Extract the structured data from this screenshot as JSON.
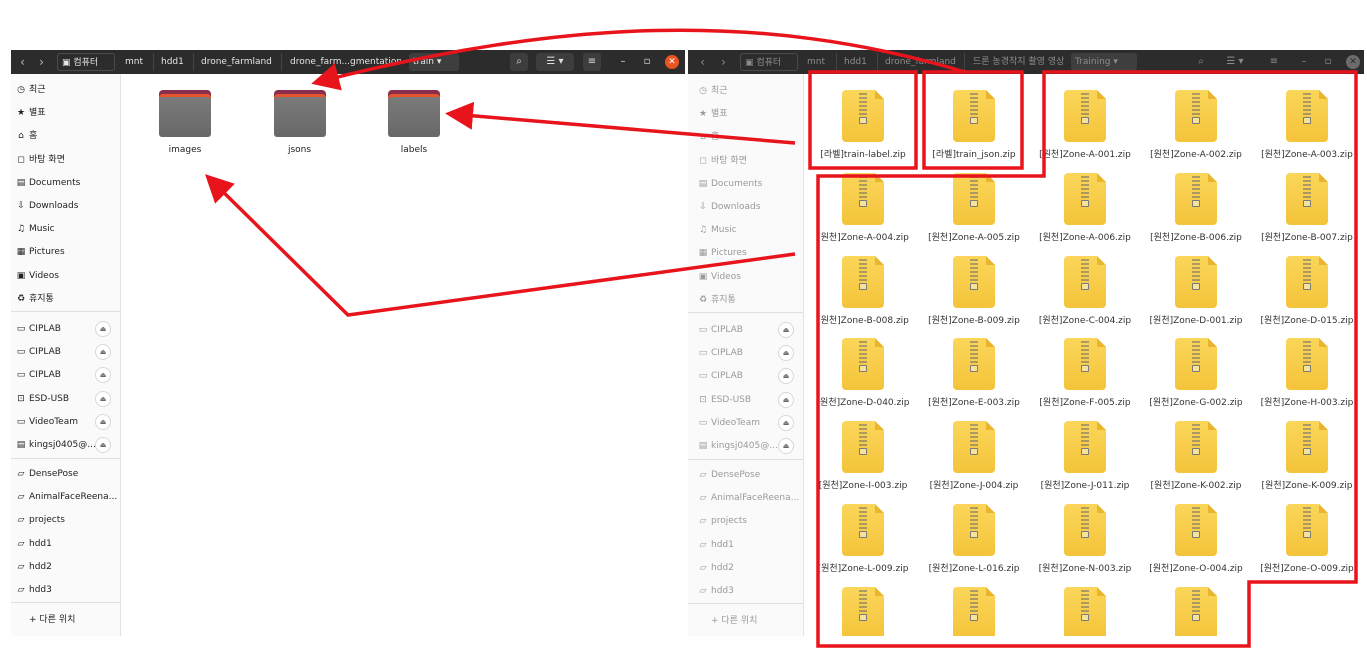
{
  "left": {
    "crumbs": [
      "컴퓨터",
      "mnt",
      "hdd1",
      "drone_farmland",
      "drone_farm...gmentation",
      "train"
    ],
    "sidebar": [
      {
        "label": "최근",
        "icon": "clock-icon"
      },
      {
        "label": "별표",
        "icon": "star-icon"
      },
      {
        "label": "홈",
        "icon": "home-icon"
      },
      {
        "label": "바탕 화면",
        "icon": "desktop-icon"
      },
      {
        "label": "Documents",
        "icon": "document-icon"
      },
      {
        "label": "Downloads",
        "icon": "download-icon"
      },
      {
        "label": "Music",
        "icon": "music-icon"
      },
      {
        "label": "Pictures",
        "icon": "picture-icon"
      },
      {
        "label": "Videos",
        "icon": "video-icon"
      },
      {
        "label": "휴지통",
        "icon": "trash-icon"
      },
      {
        "label": "CIPLAB",
        "icon": "drive-icon"
      },
      {
        "label": "CIPLAB",
        "icon": "drive-icon"
      },
      {
        "label": "CIPLAB",
        "icon": "drive-icon"
      },
      {
        "label": "ESD-USB",
        "icon": "usb-icon"
      },
      {
        "label": "VideoTeam",
        "icon": "drive-icon"
      },
      {
        "label": "kingsj0405@...",
        "icon": "network-drive-icon"
      },
      {
        "label": "DensePose",
        "icon": "folder-icon"
      },
      {
        "label": "AnimalFaceReena...",
        "icon": "folder-icon"
      },
      {
        "label": "projects",
        "icon": "folder-icon"
      },
      {
        "label": "hdd1",
        "icon": "folder-icon"
      },
      {
        "label": "hdd2",
        "icon": "folder-icon"
      },
      {
        "label": "hdd3",
        "icon": "folder-icon"
      },
      {
        "label": "+ 다른 위치",
        "icon": "plus-icon"
      }
    ],
    "folders": [
      "images",
      "jsons",
      "labels"
    ]
  },
  "right": {
    "crumbs": [
      "컴퓨터",
      "mnt",
      "hdd1",
      "drone_farmland",
      "드론 농경작지 촬영 영상",
      "Training"
    ],
    "sidebar": [
      {
        "label": "최근",
        "icon": "clock-icon"
      },
      {
        "label": "별표",
        "icon": "star-icon"
      },
      {
        "label": "홈",
        "icon": "home-icon"
      },
      {
        "label": "바탕 화면",
        "icon": "desktop-icon"
      },
      {
        "label": "Documents",
        "icon": "document-icon"
      },
      {
        "label": "Downloads",
        "icon": "download-icon"
      },
      {
        "label": "Music",
        "icon": "music-icon"
      },
      {
        "label": "Pictures",
        "icon": "picture-icon"
      },
      {
        "label": "Videos",
        "icon": "video-icon"
      },
      {
        "label": "휴지통",
        "icon": "trash-icon"
      },
      {
        "label": "CIPLAB",
        "icon": "drive-icon"
      },
      {
        "label": "CIPLAB",
        "icon": "drive-icon"
      },
      {
        "label": "CIPLAB",
        "icon": "drive-icon"
      },
      {
        "label": "ESD-USB",
        "icon": "usb-icon"
      },
      {
        "label": "VideoTeam",
        "icon": "drive-icon"
      },
      {
        "label": "kingsj0405@...",
        "icon": "network-drive-icon"
      },
      {
        "label": "DensePose",
        "icon": "folder-icon"
      },
      {
        "label": "AnimalFaceReena...",
        "icon": "folder-icon"
      },
      {
        "label": "projects",
        "icon": "folder-icon"
      },
      {
        "label": "hdd1",
        "icon": "folder-icon"
      },
      {
        "label": "hdd2",
        "icon": "folder-icon"
      },
      {
        "label": "hdd3",
        "icon": "folder-icon"
      },
      {
        "label": "+ 다른 위치",
        "icon": "plus-icon"
      }
    ],
    "files": [
      "[라벨]train-label.zip",
      "[라벨]train_json.zip",
      "[원천]Zone-A-001.zip",
      "[원천]Zone-A-002.zip",
      "[원천]Zone-A-003.zip",
      "[원천]Zone-A-004.zip",
      "[원천]Zone-A-005.zip",
      "[원천]Zone-A-006.zip",
      "[원천]Zone-B-006.zip",
      "[원천]Zone-B-007.zip",
      "[원천]Zone-B-008.zip",
      "[원천]Zone-B-009.zip",
      "[원천]Zone-C-004.zip",
      "[원천]Zone-D-001.zip",
      "[원천]Zone-D-015.zip",
      "[원천]Zone-D-040.zip",
      "[원천]Zone-E-003.zip",
      "[원천]Zone-F-005.zip",
      "[원천]Zone-G-002.zip",
      "[원천]Zone-H-003.zip",
      "[원천]Zone-I-003.zip",
      "[원천]Zone-J-004.zip",
      "[원천]Zone-J-011.zip",
      "[원천]Zone-K-002.zip",
      "[원천]Zone-K-009.zip",
      "[원천]Zone-L-009.zip",
      "[원천]Zone-L-016.zip",
      "[원천]Zone-N-003.zip",
      "[원천]Zone-O-004.zip",
      "[원천]Zone-O-009.zip",
      "",
      "",
      "",
      ""
    ]
  },
  "colors": {
    "annotation": "#e8141c",
    "header": "#2c2c2c",
    "close": "#e95420",
    "zip": "#f7c948",
    "folder": "#6f6f6f"
  }
}
